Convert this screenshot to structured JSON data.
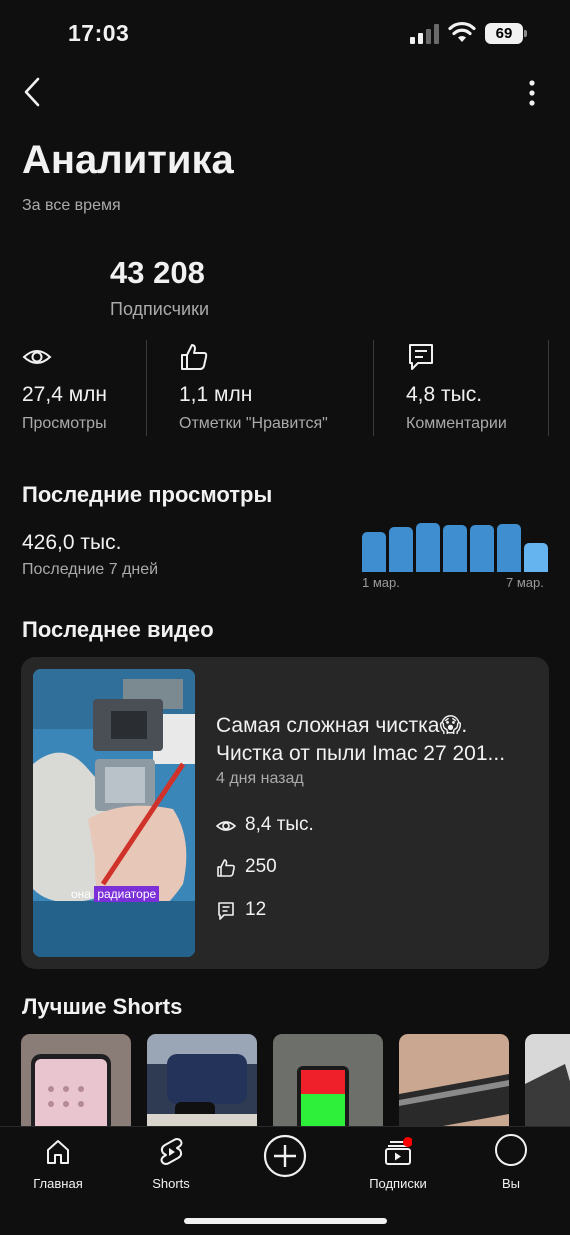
{
  "status_bar": {
    "time": "17:03",
    "battery": "69"
  },
  "header": {
    "title": "Аналитика",
    "subtitle": "За все время"
  },
  "subscribers": {
    "count": "43 208",
    "label": "Подписчики"
  },
  "stats": [
    {
      "icon": "eye-icon",
      "value": "27,4 млн",
      "label": "Просмотры"
    },
    {
      "icon": "thumbs-up-icon",
      "value": "1,1 млн",
      "label": "Отметки \"Нравится\""
    },
    {
      "icon": "comment-icon",
      "value": "4,8 тыс.",
      "label": "Комментарии"
    }
  ],
  "recent_views": {
    "title": "Последние просмотры",
    "value": "426,0 тыс.",
    "period": "Последние 7 дней",
    "x_start": "1 мар.",
    "x_end": "7 мар."
  },
  "chart_data": {
    "type": "bar",
    "categories": [
      "1 мар.",
      "2 мар.",
      "3 мар.",
      "4 мар.",
      "5 мар.",
      "6 мар.",
      "7 мар."
    ],
    "values": [
      0.77,
      0.86,
      0.95,
      0.9,
      0.9,
      0.93,
      0.56
    ],
    "colors": [
      "#3e8ed0",
      "#3e8ed0",
      "#3e8ed0",
      "#3e8ed0",
      "#3e8ed0",
      "#3e8ed0",
      "#65b4f0"
    ],
    "title": "",
    "xlabel": "",
    "ylabel": ""
  },
  "latest_video": {
    "section_title": "Последнее видео",
    "title_line1": "Самая сложная чистка😱.",
    "title_line2": "Чистка от пыли Imac 27 201...",
    "date": "4 дня назад",
    "views": "8,4 тыс.",
    "likes": "250",
    "comments": "12",
    "thumb_caption_a": "она",
    "thumb_caption_b": "радиаторе"
  },
  "best_shorts": {
    "title": "Лучшие Shorts"
  },
  "nav": [
    {
      "icon": "home-icon",
      "label": "Главная"
    },
    {
      "icon": "shorts-icon",
      "label": "Shorts"
    },
    {
      "icon": "subscriptions-icon",
      "label": "Подписки"
    },
    {
      "icon": "avatar-icon",
      "label": "Вы"
    }
  ],
  "colors": {
    "background": "#0f0f0f",
    "card": "#272727",
    "bar": "#3e8ed0",
    "bar_highlight": "#65b4f0",
    "notification": "#ff0000"
  }
}
